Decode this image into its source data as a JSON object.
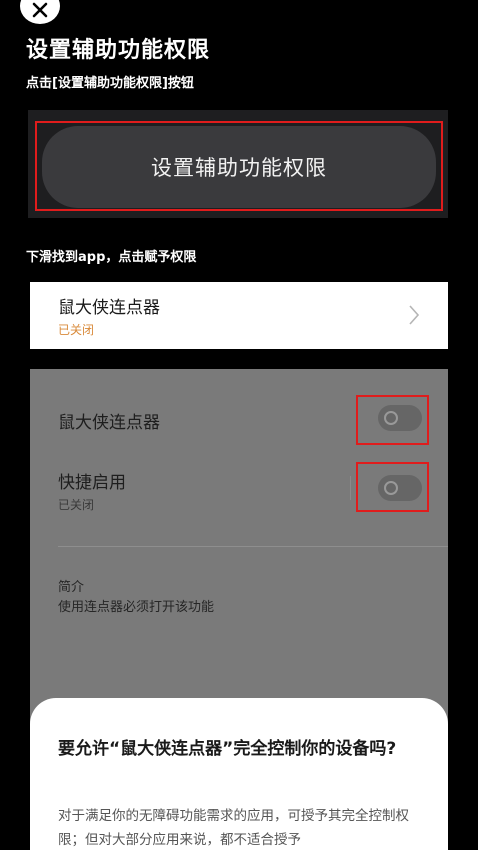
{
  "header": {
    "title": "设置辅助功能权限",
    "subtitle": "点击[设置辅助功能权限]按钮"
  },
  "setup_button": {
    "label": "设置辅助功能权限"
  },
  "instruction": "下滑找到app，点击赋予权限",
  "app_card": {
    "name": "鼠大侠连点器",
    "status": "已关闭"
  },
  "settings": {
    "service_label": "鼠大侠连点器",
    "shortcut_label": "快捷启用",
    "shortcut_status": "已关闭",
    "intro_title": "简介",
    "intro_text": "使用连点器必须打开该功能",
    "service_enabled": false,
    "shortcut_enabled": false
  },
  "dialog": {
    "title": "要允许“鼠大侠连点器”完全控制你的设备吗?",
    "body": "对于满足你的无障碍功能需求的应用，可授予其完全控制权限；但对大部分应用来说，都不适合授予"
  },
  "colors": {
    "highlight_border": "#e01c1c",
    "status_orange": "#d98a3a"
  }
}
